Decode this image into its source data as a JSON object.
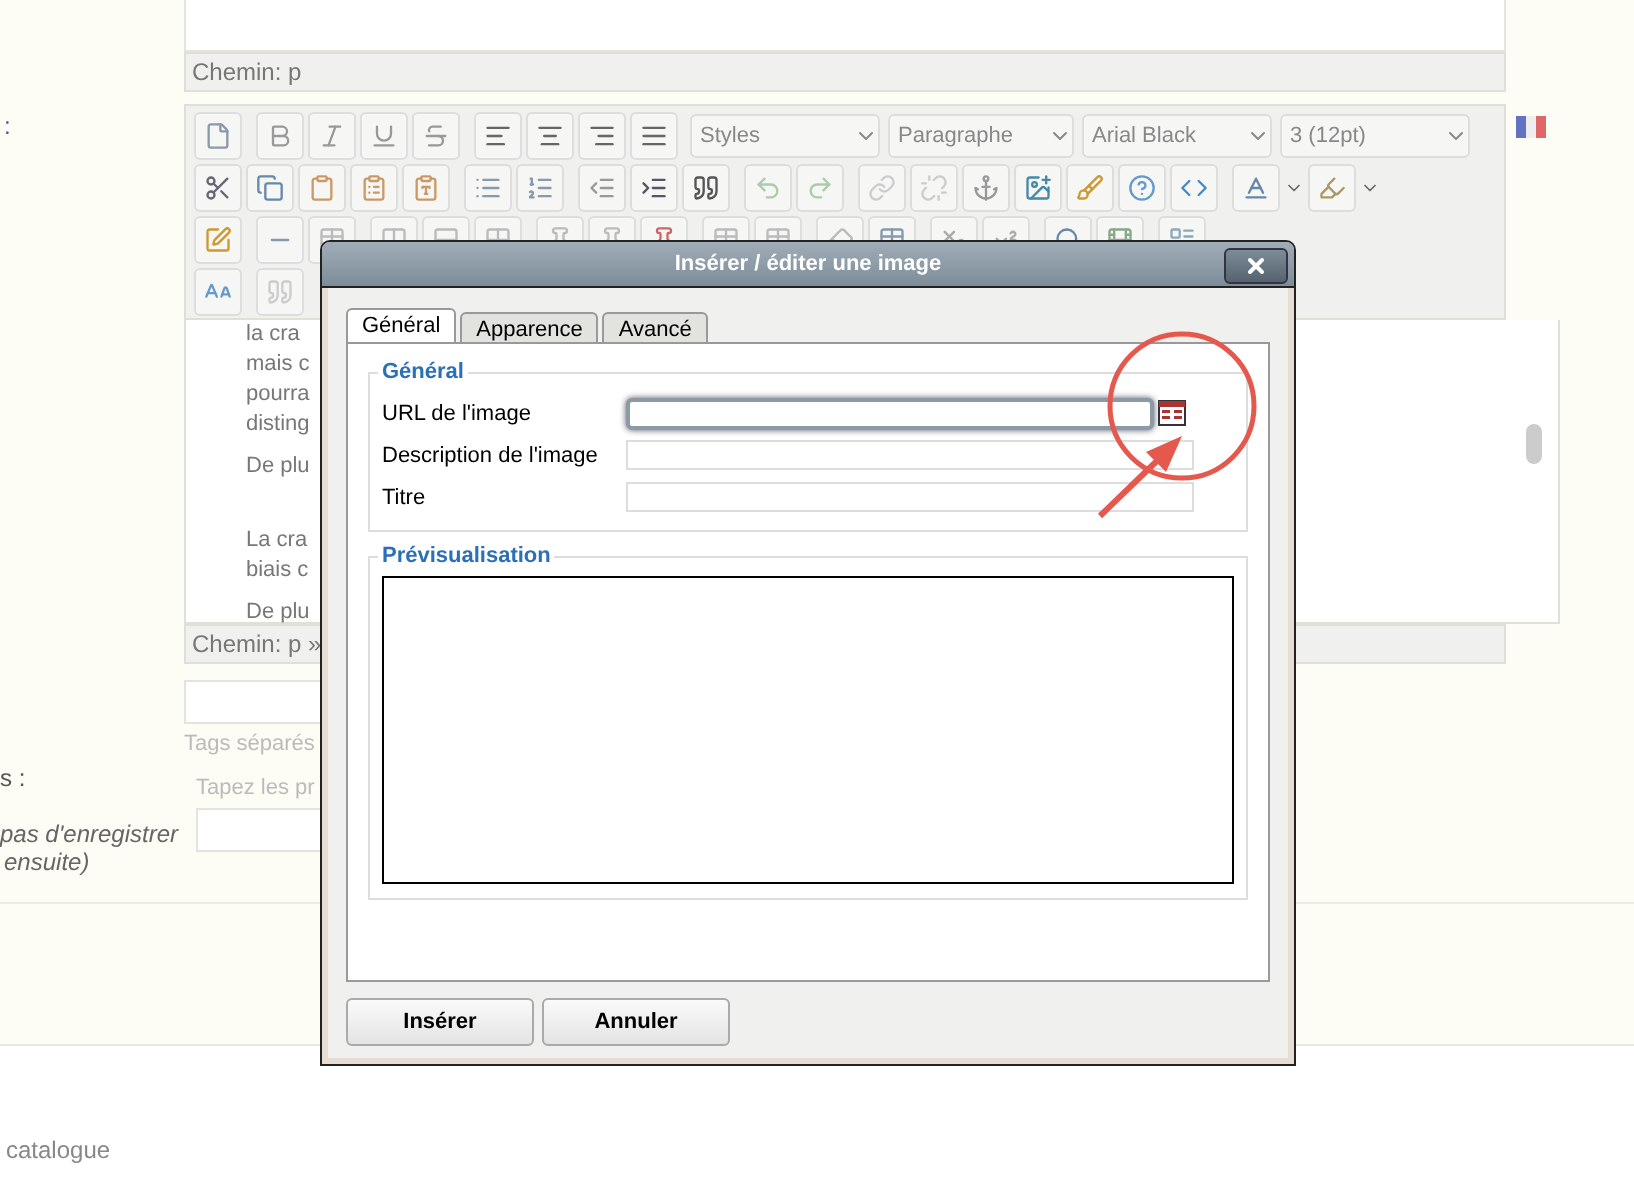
{
  "top_editor": {
    "path": "Chemin: p"
  },
  "editor_label": ":",
  "editor": {
    "selects": [
      "Styles",
      "Paragraphe",
      "Arial Black",
      "3 (12pt)"
    ],
    "paragraphs": [
      [
        "la cra",
        "mais c",
        "pourra",
        "disting"
      ],
      [
        "De plu"
      ],
      [
        "La cra",
        "biais c"
      ],
      [
        "De plu"
      ]
    ],
    "path": "Chemin: p »"
  },
  "tags_hint": "Tags séparés",
  "second_label": "s :",
  "second_hint": "Tapez les pr",
  "note_lines": [
    "pas d'enregistrer",
    "ensuite)"
  ],
  "footer_text": "catalogue",
  "dialog": {
    "title": "Insérer / éditer une image",
    "tabs": [
      {
        "label": "Général",
        "selected": true
      },
      {
        "label": "Apparence",
        "selected": false
      },
      {
        "label": "Avancé",
        "selected": false
      }
    ],
    "general_legend": "Général",
    "fields": [
      {
        "label": "URL de l'image",
        "focused": true,
        "browse": true
      },
      {
        "label": "Description de l'image",
        "focused": false,
        "browse": false
      },
      {
        "label": "Titre",
        "focused": false,
        "browse": false
      }
    ],
    "preview_legend": "Prévisualisation",
    "buttons": [
      "Insérer",
      "Annuler"
    ]
  }
}
